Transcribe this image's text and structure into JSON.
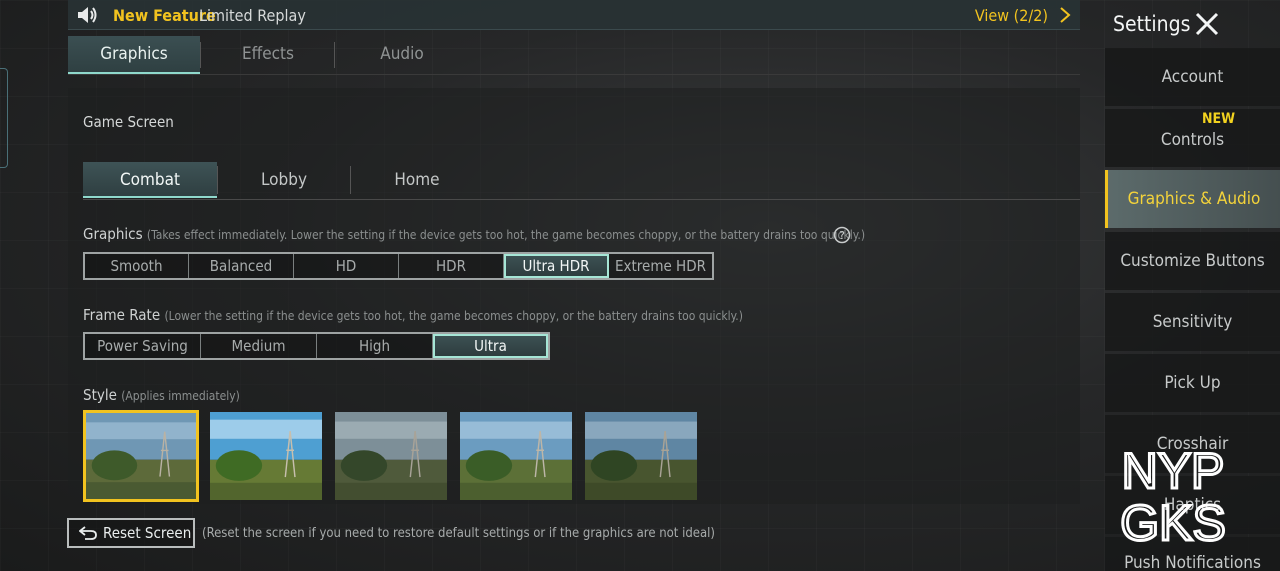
{
  "announcement": {
    "feature_label": "New Feature",
    "message": "Limited Replay",
    "view_label": "View (2/2)",
    "icons": [
      "speaker-icon",
      "chevron-right-icon"
    ]
  },
  "top_tabs": [
    {
      "label": "Graphics",
      "active": true
    },
    {
      "label": "Effects",
      "active": false
    },
    {
      "label": "Audio",
      "active": false
    }
  ],
  "main": {
    "section_title": "Game Screen",
    "sub_tabs": [
      {
        "label": "Combat",
        "active": true
      },
      {
        "label": "Lobby",
        "active": false
      },
      {
        "label": "Home",
        "active": false
      }
    ],
    "graphics": {
      "label": "Graphics",
      "hint": "(Takes effect immediately. Lower the setting if the device gets too hot, the game becomes choppy, or the battery drains too quickly.)",
      "options": [
        "Smooth",
        "Balanced",
        "HD",
        "HDR",
        "Ultra HDR",
        "Extreme HDR"
      ],
      "selected": "Ultra HDR"
    },
    "frame_rate": {
      "label": "Frame Rate",
      "hint": "(Lower the setting if the device gets too hot, the game becomes choppy, or the battery drains too quickly.)",
      "options": [
        "Power Saving",
        "Medium",
        "High",
        "Ultra"
      ],
      "selected": "Ultra"
    },
    "style": {
      "label": "Style",
      "hint": "(Applies immediately)",
      "thumbnails": 5,
      "selected_index": 0
    },
    "reset_button": "Reset Screen",
    "reset_hint": "(Reset the screen if you need to restore default settings or if the graphics are not ideal)"
  },
  "sidebar": {
    "title": "Settings",
    "new_badge": "NEW",
    "items": [
      {
        "label": "Account",
        "active": false
      },
      {
        "label": "Controls",
        "active": false
      },
      {
        "label": "Graphics & Audio",
        "active": true
      },
      {
        "label": "Customize Buttons",
        "active": false
      },
      {
        "label": "Sensitivity",
        "active": false
      },
      {
        "label": "Pick Up",
        "active": false
      },
      {
        "label": "Crosshair",
        "active": false
      },
      {
        "label": "Haptics",
        "active": false
      },
      {
        "label": "Push Notifications",
        "active": false
      }
    ]
  },
  "watermark": {
    "line1": "NYP",
    "line2": "GKS"
  },
  "colors": {
    "accent_yellow": "#f2c31f",
    "accent_teal": "#8fd9cc"
  }
}
